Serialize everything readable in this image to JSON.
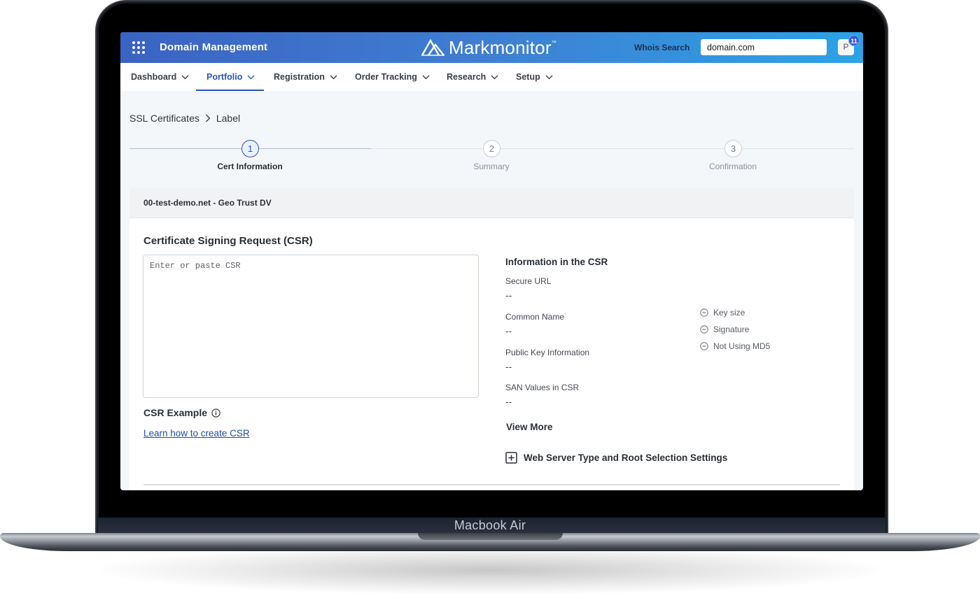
{
  "device": {
    "label": "Macbook Air"
  },
  "topbar": {
    "app_title": "Domain Management",
    "brand": "Markmonitor",
    "brand_tm": "™",
    "whois_label": "Whois Search",
    "whois_value": "domain.com",
    "avatar_initial": "P",
    "notification_count": "11",
    "accent_gradient": [
      "#3b63c2",
      "#2ba3e6"
    ]
  },
  "nav": {
    "items": [
      {
        "label": "Dashboard",
        "active": false
      },
      {
        "label": "Portfolio",
        "active": true
      },
      {
        "label": "Registration",
        "active": false
      },
      {
        "label": "Order Tracking",
        "active": false
      },
      {
        "label": "Research",
        "active": false
      },
      {
        "label": "Setup",
        "active": false
      }
    ],
    "active_color": "#2a55b8"
  },
  "breadcrumb": {
    "items": [
      "SSL Certificates",
      "Label"
    ]
  },
  "stepper": {
    "steps": [
      {
        "number": "1",
        "label": "Cert Information",
        "active": true
      },
      {
        "number": "2",
        "label": "Summary",
        "active": false
      },
      {
        "number": "3",
        "label": "Confirmation",
        "active": false
      }
    ]
  },
  "card": {
    "header": "00-test-demo.net - Geo Trust DV",
    "csr_title": "Certificate Signing Request (CSR)",
    "csr_placeholder": "Enter or paste CSR",
    "csr_value": "",
    "csr_example_label": "CSR Example",
    "learn_link": "Learn how to create CSR",
    "info_title": "Information in the CSR",
    "fields": [
      {
        "label": "Secure URL",
        "value": "--"
      },
      {
        "label": "Common Name",
        "value": "--"
      },
      {
        "label": "Public Key Information",
        "value": "--"
      },
      {
        "label": "SAN Values in CSR",
        "value": "--"
      }
    ],
    "checks": [
      {
        "label": "Key size"
      },
      {
        "label": "Signature"
      },
      {
        "label": "Not Using MD5"
      }
    ],
    "view_more": "View More",
    "webserver_settings": "Web Server Type and Root Selection Settings"
  }
}
